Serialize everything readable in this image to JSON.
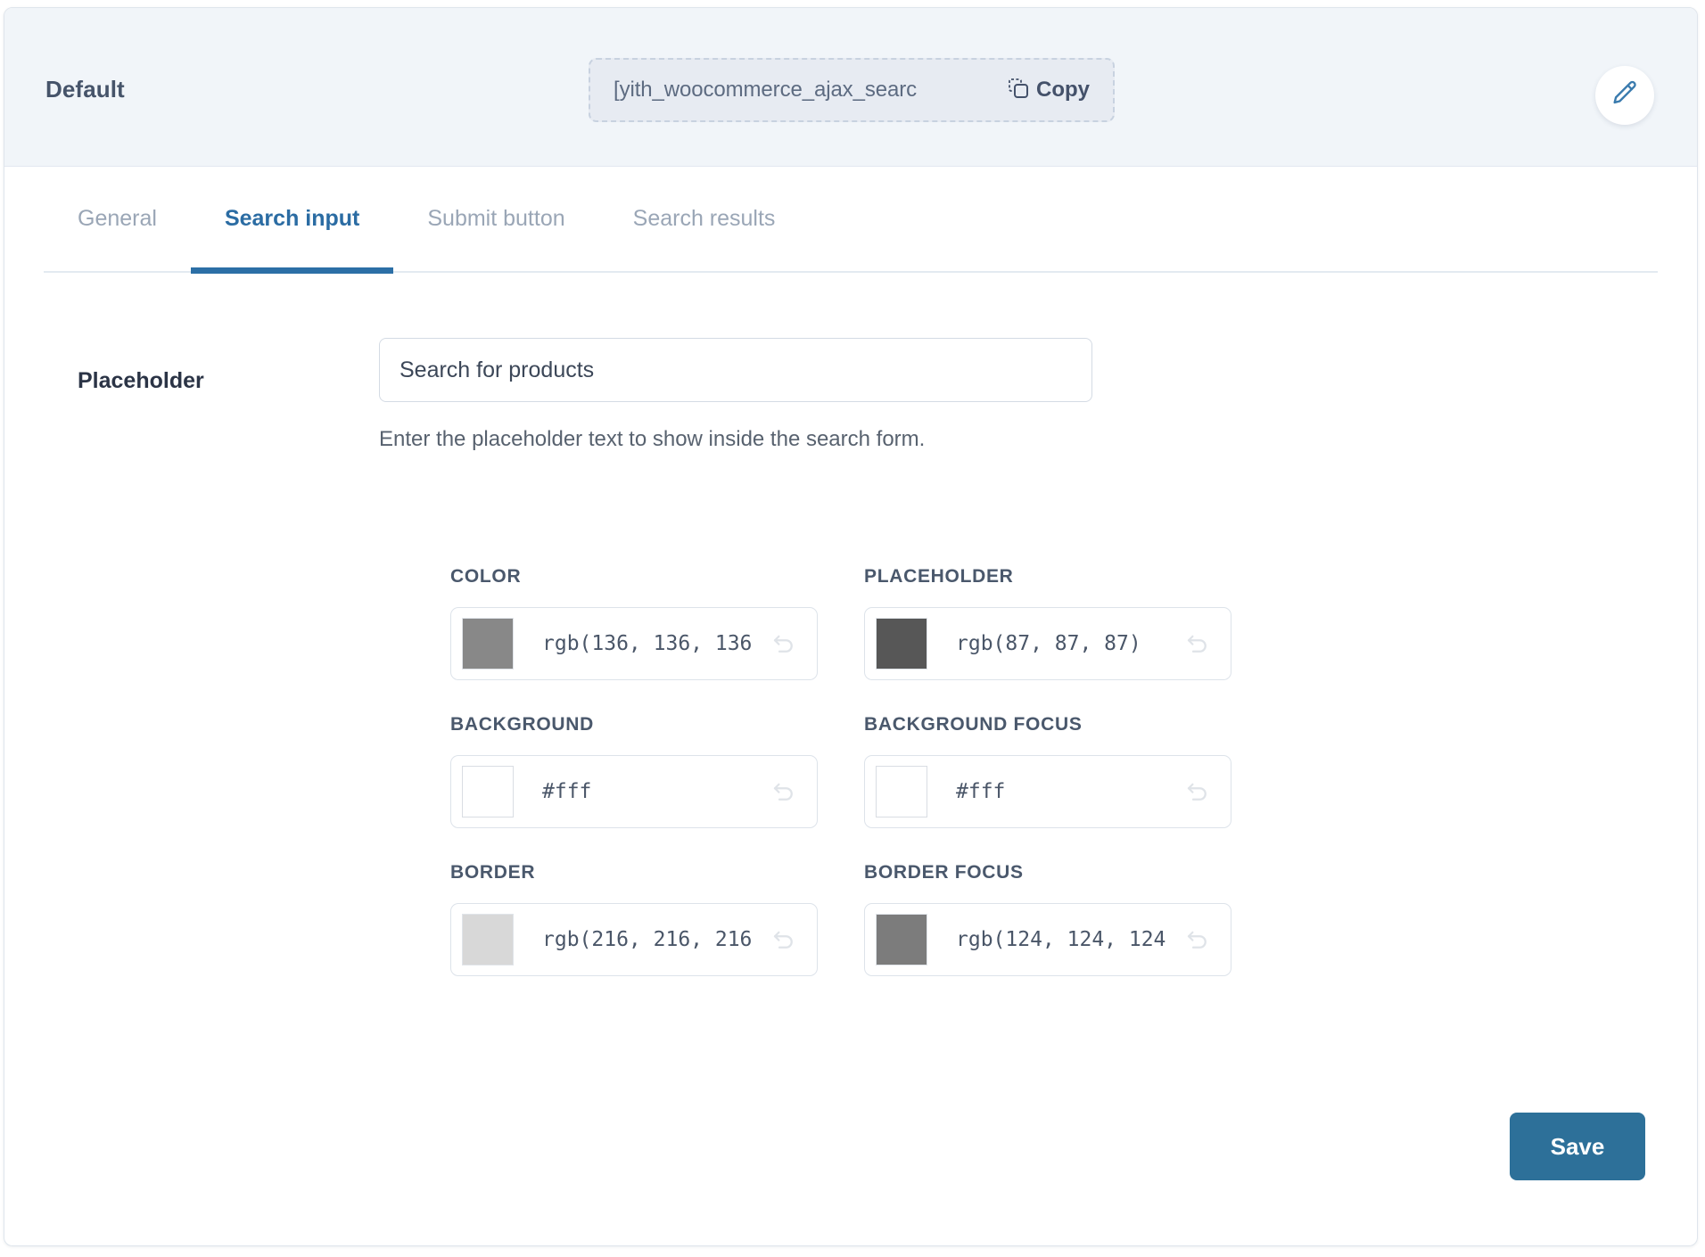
{
  "header": {
    "title": "Default",
    "shortcode": "[yith_woocommerce_ajax_searc",
    "copy_label": "Copy",
    "copy_icon": "copy-icon",
    "edit_icon": "pencil-icon"
  },
  "tabs": [
    {
      "label": "General",
      "active": false
    },
    {
      "label": "Search input",
      "active": true
    },
    {
      "label": "Submit button",
      "active": false
    },
    {
      "label": "Search results",
      "active": false
    }
  ],
  "placeholder_field": {
    "label": "Placeholder",
    "value": "Search for products",
    "placeholder": "Search for products",
    "hint": "Enter the placeholder text to show inside the search form."
  },
  "colors": [
    {
      "caption": "COLOR",
      "value": "rgb(136, 136, 136",
      "swatch": "#888888",
      "reset_icon": "undo-icon"
    },
    {
      "caption": "PLACEHOLDER",
      "value": "rgb(87, 87, 87)",
      "swatch": "#575757",
      "reset_icon": "undo-icon"
    },
    {
      "caption": "BACKGROUND",
      "value": "#fff",
      "swatch": "#ffffff",
      "reset_icon": "undo-icon"
    },
    {
      "caption": "BACKGROUND FOCUS",
      "value": "#fff",
      "swatch": "#ffffff",
      "reset_icon": "undo-icon"
    },
    {
      "caption": "BORDER",
      "value": "rgb(216, 216, 216",
      "swatch": "#d8d8d8",
      "reset_icon": "undo-icon"
    },
    {
      "caption": "BORDER FOCUS",
      "value": "rgb(124, 124, 124",
      "swatch": "#7c7c7c",
      "reset_icon": "undo-icon"
    }
  ],
  "footer": {
    "save_label": "Save"
  },
  "theme": {
    "accent": "#2c6fa6",
    "save_bg": "#2d7099",
    "header_bg": "#f1f5f9",
    "muted_text": "#9aa6b6"
  }
}
